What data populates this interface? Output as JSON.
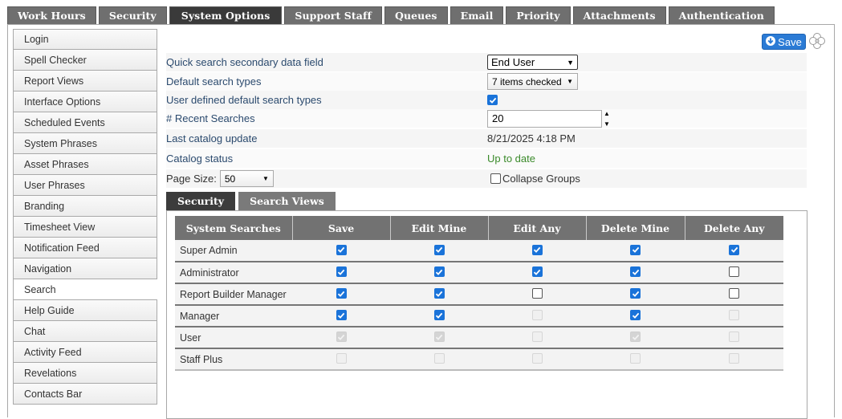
{
  "top_tabs": [
    "Work Hours",
    "Security",
    "System Options",
    "Support Staff",
    "Queues",
    "Email",
    "Priority",
    "Attachments",
    "Authentication"
  ],
  "active_top_tab": "System Options",
  "sidebar": {
    "items": [
      "Login",
      "Spell Checker",
      "Report Views",
      "Interface Options",
      "Scheduled Events",
      "System Phrases",
      "Asset Phrases",
      "User Phrases",
      "Branding",
      "Timesheet View",
      "Notification Feed",
      "Navigation",
      "Search",
      "Help Guide",
      "Chat",
      "Activity Feed",
      "Revelations",
      "Contacts Bar"
    ],
    "active": "Search"
  },
  "toolbar": {
    "save_label": "Save"
  },
  "form": {
    "quick_search_label": "Quick search secondary data field",
    "quick_search_value": "End User",
    "default_types_label": "Default search types",
    "default_types_value": "7 items checked",
    "user_defined_label": "User defined default search types",
    "user_defined_checked": true,
    "recent_label": "# Recent Searches",
    "recent_value": "20",
    "last_update_label": "Last catalog update",
    "last_update_value": "8/21/2025 4:18 PM",
    "status_label": "Catalog status",
    "status_value": "Up to date",
    "page_size_label": "Page Size:",
    "page_size_value": "50",
    "collapse_label": "Collapse Groups",
    "collapse_checked": false
  },
  "inner_tabs": [
    "Security",
    "Search Views"
  ],
  "active_inner_tab": "Security",
  "table": {
    "headers": [
      "System Searches",
      "Save",
      "Edit Mine",
      "Edit Any",
      "Delete Mine",
      "Delete Any"
    ],
    "rows": [
      {
        "name": "Super Admin",
        "cells": [
          "checked",
          "checked",
          "checked",
          "checked",
          "checked"
        ]
      },
      {
        "name": "Administrator",
        "cells": [
          "checked",
          "checked",
          "checked",
          "checked",
          "unchecked"
        ]
      },
      {
        "name": "Report Builder Manager",
        "cells": [
          "checked",
          "checked",
          "unchecked",
          "checked",
          "unchecked"
        ]
      },
      {
        "name": "Manager",
        "cells": [
          "checked",
          "checked",
          "dis-unchecked",
          "checked",
          "dis-unchecked"
        ]
      },
      {
        "name": "User",
        "cells": [
          "dis-checked",
          "dis-checked",
          "dis-unchecked",
          "dis-checked",
          "dis-unchecked"
        ]
      },
      {
        "name": "Staff Plus",
        "cells": [
          "dis-unchecked",
          "dis-unchecked",
          "dis-unchecked",
          "dis-unchecked",
          "dis-unchecked"
        ]
      }
    ]
  },
  "colors": {
    "accent": "#2b7bd5",
    "checkbox": "#1a73d9",
    "status_ok": "#3a8a2a",
    "tab_bg": "#6f6f6f"
  }
}
